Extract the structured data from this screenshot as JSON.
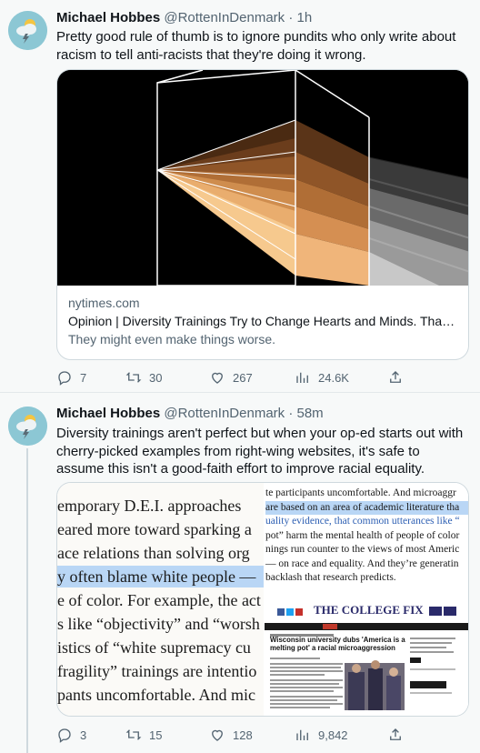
{
  "tweets": [
    {
      "author_name": "Michael Hobbes",
      "handle": "@RottenInDenmark",
      "sep": "·",
      "time": "1h",
      "text": "Pretty good rule of thumb is to ignore pundits who only write about racism to tell anti-racists that they're doing it wrong.",
      "card": {
        "domain": "nytimes.com",
        "title": "Opinion | Diversity Trainings Try to Change Hearts and Minds. That's a...",
        "description": "They might even make things worse."
      },
      "replies": "7",
      "retweets": "30",
      "likes": "267",
      "views": "24.6K"
    },
    {
      "author_name": "Michael Hobbes",
      "handle": "@RottenInDenmark",
      "sep": "·",
      "time": "58m",
      "text": "Diversity trainings aren't perfect but when your op-ed starts out with cherry-picked examples from right-wing websites, it's safe to assume this isn't a good-faith effort to improve racial equality.",
      "media": {
        "left_lines": [
          "emporary D.E.I. approaches",
          "eared more toward sparking a",
          "ace relations than solving org",
          "y often blame white people —",
          "e of color. For example, the act",
          "s like “objectivity” and “worsh",
          "istics of “white supremacy cu",
          "fragility” trainings are intentio",
          "pants uncomfortable. And mic"
        ],
        "right_lines": [
          "te participants uncomfortable. And microaggr",
          "are based on an area of academic literature tha",
          "uality evidence, that common utterances like “",
          "pot” harm the mental health of people of color",
          "nings run counter to the views of most Americ",
          "— on race and equality. And they’re generatin",
          "backlash that research predicts."
        ],
        "site_name": "THE COLLEGE FIX",
        "article_headline": "Wisconsin university dubs 'America is a melting pot' a racial microaggression"
      },
      "replies": "3",
      "retweets": "15",
      "likes": "128",
      "views": "9,842"
    }
  ],
  "icons": [
    "reply-icon",
    "retweet-icon",
    "like-icon",
    "views-icon",
    "share-icon"
  ],
  "colors": {
    "background": "#f7f9f9",
    "secondary_text": "#536471",
    "highlight": "#b9d6f5",
    "avatar_bg": "#8cc7d4"
  }
}
